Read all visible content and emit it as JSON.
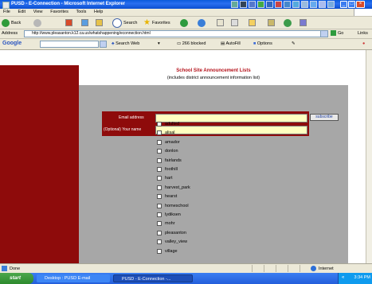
{
  "window": {
    "title": "PUSD - E-Connection - Microsoft Internet Explorer"
  },
  "menu": [
    "File",
    "Edit",
    "View",
    "Favorites",
    "Tools",
    "Help"
  ],
  "toolbar": {
    "back": "Back",
    "search": "Search",
    "favorites": "Favorites"
  },
  "address": {
    "label": "Address",
    "url": "http://www.pleasanton.k12.ca.us/whatshappening/econnection.html",
    "go": "Go",
    "links": "Links"
  },
  "googlebar": {
    "logo": "Google",
    "search_web": "Search Web",
    "blocked": "266 blocked",
    "autofill": "AutoFill",
    "options": "Options"
  },
  "page": {
    "title": "School Site Announcement Lists",
    "subtitle": "(includes district announcement information list)",
    "email_label": "Email address",
    "name_label": "(Optional) Your name",
    "subscribe": "subscribe"
  },
  "schools": [
    "adulted",
    "alisal",
    "amador",
    "donlon",
    "fairlands",
    "foothill",
    "hart",
    "harvest_park",
    "hearst",
    "homeschool",
    "lydiksen",
    "mohr",
    "pleasanton",
    "valley_view",
    "village"
  ],
  "status": {
    "text": "Done",
    "zone": "Internet"
  },
  "taskbar": {
    "start": "start",
    "task1": "Desktop : PUSD E-mail",
    "task2": "PUSD - E-Connection -...",
    "clock": "3:34 PM"
  },
  "colors": {
    "maroon": "#8e0b0b",
    "title_red": "#b5121b",
    "field_yellow": "#ffffc0"
  }
}
